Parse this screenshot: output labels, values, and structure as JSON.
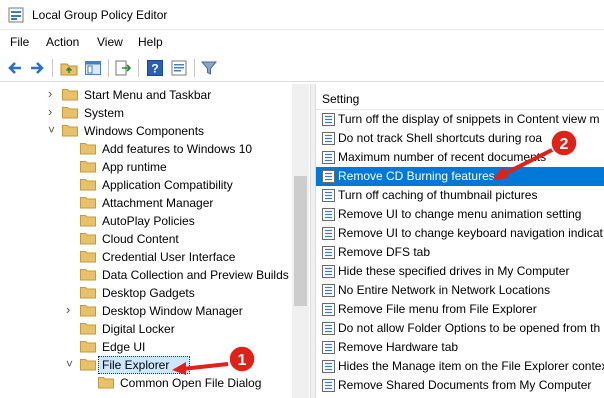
{
  "window": {
    "title": "Local Group Policy Editor"
  },
  "menu": [
    "File",
    "Action",
    "View",
    "Help"
  ],
  "toolbar_icons": [
    "back-arrow-icon",
    "forward-arrow-icon",
    "up-folder-icon",
    "show-hide-tree-icon",
    "export-list-icon",
    "help-icon",
    "properties-icon",
    "filter-icon"
  ],
  "tree": {
    "items": [
      {
        "label": "Start Menu and Taskbar",
        "expander": "collapsed"
      },
      {
        "label": "System",
        "expander": "collapsed"
      },
      {
        "label": "Windows Components",
        "expander": "expanded"
      },
      {
        "label": "Add features to Windows 10",
        "expander": "none"
      },
      {
        "label": "App runtime",
        "expander": "none"
      },
      {
        "label": "Application Compatibility",
        "expander": "none"
      },
      {
        "label": "Attachment Manager",
        "expander": "none"
      },
      {
        "label": "AutoPlay Policies",
        "expander": "none"
      },
      {
        "label": "Cloud Content",
        "expander": "none"
      },
      {
        "label": "Credential User Interface",
        "expander": "none"
      },
      {
        "label": "Data Collection and Preview Builds",
        "expander": "none"
      },
      {
        "label": "Desktop Gadgets",
        "expander": "none"
      },
      {
        "label": "Desktop Window Manager",
        "expander": "collapsed"
      },
      {
        "label": "Digital Locker",
        "expander": "none"
      },
      {
        "label": "Edge UI",
        "expander": "none"
      },
      {
        "label": "File Explorer",
        "expander": "expanded",
        "selected": true
      },
      {
        "label": "Common Open File Dialog",
        "expander": "none"
      }
    ]
  },
  "settings": {
    "header": "Setting",
    "items": [
      {
        "label": "Turn off the display of snippets in Content view m"
      },
      {
        "label": "Do not track Shell shortcuts during roa"
      },
      {
        "label": "Maximum number of recent documents"
      },
      {
        "label": "Remove CD Burning features",
        "selected": true
      },
      {
        "label": "Turn off caching of thumbnail pictures"
      },
      {
        "label": "Remove UI to change menu animation setting"
      },
      {
        "label": "Remove UI to change keyboard navigation indicat"
      },
      {
        "label": "Remove DFS tab"
      },
      {
        "label": "Hide these specified drives in My Computer"
      },
      {
        "label": "No Entire Network in Network Locations"
      },
      {
        "label": "Remove File menu from File Explorer"
      },
      {
        "label": "Do not allow Folder Options to be opened from th"
      },
      {
        "label": "Remove Hardware tab"
      },
      {
        "label": "Hides the Manage item on the File Explorer context"
      },
      {
        "label": "Remove Shared Documents from My Computer"
      }
    ]
  },
  "annotations": [
    {
      "number": "1",
      "color": "#e0211a"
    },
    {
      "number": "2",
      "color": "#e0211a"
    }
  ],
  "colors": {
    "selection": "#0078d7",
    "folder": "#e8c26a",
    "annotation": "#e0211a"
  }
}
